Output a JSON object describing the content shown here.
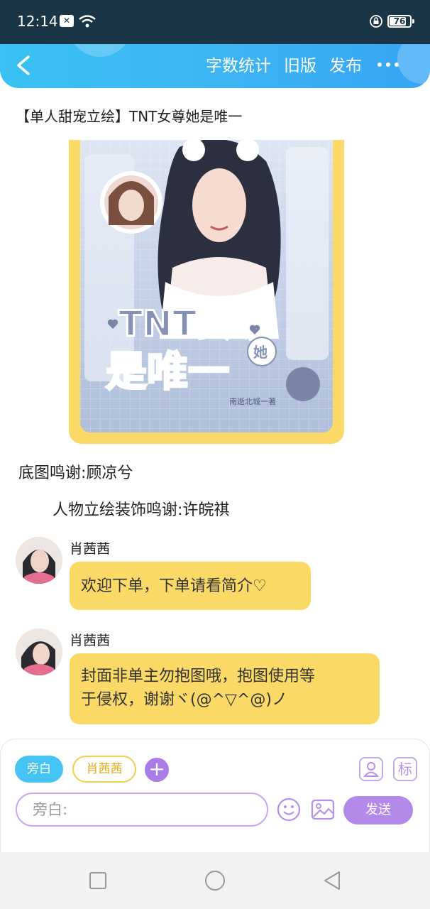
{
  "status": {
    "time": "12:14",
    "notif_icon": "close-box-icon",
    "battery": "76"
  },
  "nav": {
    "back_icon": "chevron-left-icon",
    "word_count": "字数统计",
    "old_version": "旧版",
    "publish": "发布",
    "more_icon": "more-dots-icon"
  },
  "story": {
    "title": "【单人甜宠立绘】TNT女尊她是唯一",
    "cover_text": {
      "line1": "TNT女尊",
      "line2": "是唯一",
      "badge": "她",
      "author": "南逝北城一著"
    },
    "credit_1": "底图鸣谢:顾凉兮",
    "credit_2": "人物立绘装饰鸣谢:许皖祺"
  },
  "messages": [
    {
      "name": "肖茜茜",
      "text": "欢迎下单，下单请看简介♡"
    },
    {
      "name": "肖茜茜",
      "text_line1": "封面非单主勿抱图哦，抱图使用等",
      "text_line2": "于侵权，谢谢ヾ(@^▽^@)ノ"
    }
  ],
  "composer": {
    "role_narration": "旁白",
    "role_character": "肖茜茜",
    "add_role_symbol": "+",
    "role_icon": "person-card-icon",
    "tag_label": "标",
    "input_placeholder": "旁白:",
    "emoji_icon": "smiley-icon",
    "image_icon": "image-icon",
    "send": "发送"
  },
  "colors": {
    "header": "#3db3f4",
    "bubble": "#fbd966",
    "accent_purple": "#b38ae9",
    "narration_chip": "#45c3f2"
  }
}
